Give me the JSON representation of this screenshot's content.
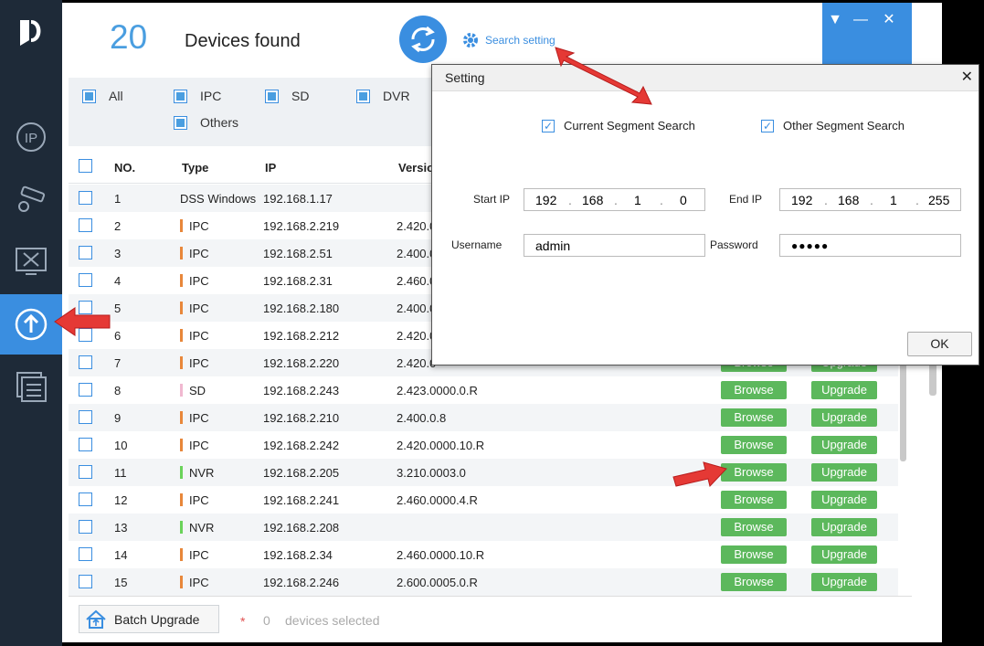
{
  "header": {
    "count": "20",
    "found_label": "Devices found",
    "search_setting_label": "Search setting"
  },
  "window_controls": {
    "dropdown": "▼",
    "minimize": "—",
    "close": "✕"
  },
  "filters": [
    {
      "label": "All",
      "checked": true
    },
    {
      "label": "IPC",
      "checked": true
    },
    {
      "label": "SD",
      "checked": true
    },
    {
      "label": "DVR",
      "checked": true
    },
    {
      "label": "Others",
      "checked": true
    }
  ],
  "table": {
    "headers": {
      "no": "NO.",
      "type": "Type",
      "ip": "IP",
      "version": "Versio"
    },
    "rows": [
      {
        "no": "1",
        "type": "DSS Windows",
        "color": "",
        "ip": "192.168.1.17",
        "version": "",
        "buttons": false
      },
      {
        "no": "2",
        "type": "IPC",
        "color": "#e8873a",
        "ip": "192.168.2.219",
        "version": "2.420.0",
        "buttons": false
      },
      {
        "no": "3",
        "type": "IPC",
        "color": "#e8873a",
        "ip": "192.168.2.51",
        "version": "2.400.0",
        "buttons": false
      },
      {
        "no": "4",
        "type": "IPC",
        "color": "#e8873a",
        "ip": "192.168.2.31",
        "version": "2.460.0",
        "buttons": false
      },
      {
        "no": "5",
        "type": "IPC",
        "color": "#e8873a",
        "ip": "192.168.2.180",
        "version": "2.400.0",
        "buttons": false
      },
      {
        "no": "6",
        "type": "IPC",
        "color": "#e8873a",
        "ip": "192.168.2.212",
        "version": "2.420.0",
        "buttons": false
      },
      {
        "no": "7",
        "type": "IPC",
        "color": "#e8873a",
        "ip": "192.168.2.220",
        "version": "2.420.0",
        "buttons": true
      },
      {
        "no": "8",
        "type": "SD",
        "color": "#f0b8d0",
        "ip": "192.168.2.243",
        "version": "2.423.0000.0.R",
        "buttons": true
      },
      {
        "no": "9",
        "type": "IPC",
        "color": "#e8873a",
        "ip": "192.168.2.210",
        "version": "2.400.0.8",
        "buttons": true
      },
      {
        "no": "10",
        "type": "IPC",
        "color": "#e8873a",
        "ip": "192.168.2.242",
        "version": "2.420.0000.10.R",
        "buttons": true
      },
      {
        "no": "11",
        "type": "NVR",
        "color": "#6ad35a",
        "ip": "192.168.2.205",
        "version": "3.210.0003.0",
        "buttons": true
      },
      {
        "no": "12",
        "type": "IPC",
        "color": "#e8873a",
        "ip": "192.168.2.241",
        "version": "2.460.0000.4.R",
        "buttons": true
      },
      {
        "no": "13",
        "type": "NVR",
        "color": "#6ad35a",
        "ip": "192.168.2.208",
        "version": "",
        "buttons": true
      },
      {
        "no": "14",
        "type": "IPC",
        "color": "#e8873a",
        "ip": "192.168.2.34",
        "version": "2.460.0000.10.R",
        "buttons": true
      },
      {
        "no": "15",
        "type": "IPC",
        "color": "#e8873a",
        "ip": "192.168.2.246",
        "version": "2.600.0005.0.R",
        "buttons": true
      }
    ],
    "browse_label": "Browse",
    "upgrade_label": "Upgrade"
  },
  "footer": {
    "batch_label": "Batch Upgrade",
    "star": "*",
    "selected_count": "0",
    "selected_label": "devices selected"
  },
  "dialog": {
    "title": "Setting",
    "close": "✕",
    "current_segment_label": "Current Segment Search",
    "other_segment_label": "Other Segment Search",
    "start_ip_label": "Start IP",
    "start_ip": [
      "192",
      "168",
      "1",
      "0"
    ],
    "end_ip_label": "End IP",
    "end_ip": [
      "192",
      "168",
      "1",
      "255"
    ],
    "username_label": "Username",
    "username": "admin",
    "password_label": "Password",
    "password": "●●●●●",
    "ok_label": "OK"
  },
  "colors": {
    "accent": "#3a8ee0",
    "sidebar": "#1e2a38",
    "button_green": "#5cb85c",
    "arrow": "#e53935"
  }
}
